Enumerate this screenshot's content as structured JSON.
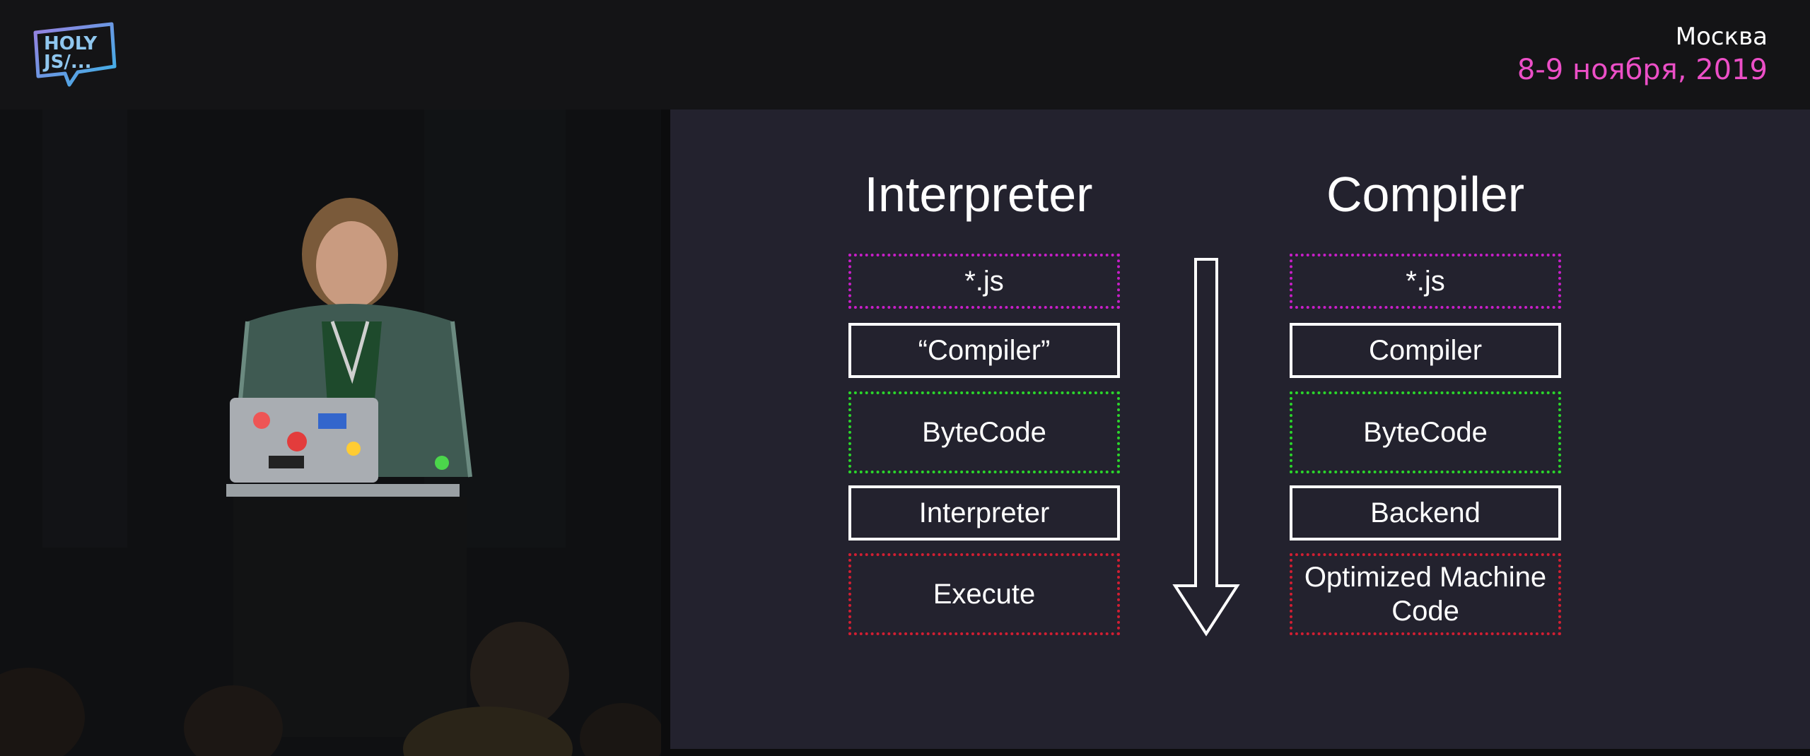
{
  "header": {
    "city": "Москва",
    "dates": "8-9 ноября, 2019",
    "logo_text": "HOLY JS/...",
    "date_color": "#ec4fc7"
  },
  "slide": {
    "left_column": {
      "title": "Interpreter",
      "steps": [
        "*.js",
        "“Compiler”",
        "ByteCode",
        "Interpreter",
        "Execute"
      ]
    },
    "right_column": {
      "title": "Compiler",
      "steps": [
        "*.js",
        "Compiler",
        "ByteCode",
        "Backend",
        "Optimized Machine Code"
      ]
    },
    "flow_arrow": "arrow-down-icon",
    "step_border_colors": {
      "source": "#c81ec8",
      "tool": "#ffffff",
      "bytecode": "#2bd62b",
      "output": "#d21e32"
    },
    "background": "#23222e"
  }
}
